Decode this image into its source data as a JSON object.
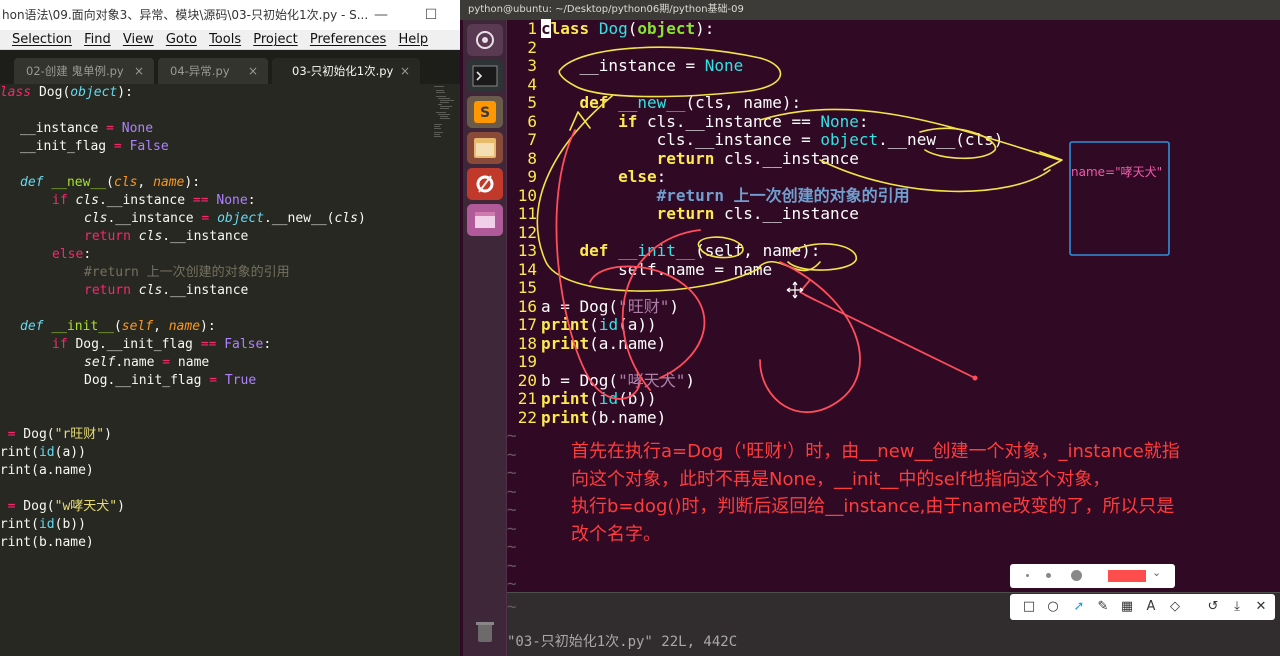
{
  "sublime": {
    "title": "hon语法\\09.面向对象3、异常、模块\\源码\\03-只初始化1次.py - S...",
    "menu": [
      "Selection",
      "Find",
      "View",
      "Goto",
      "Tools",
      "Project",
      "Preferences",
      "Help"
    ],
    "tabs": [
      {
        "label": "02-创建    鬼单例.py",
        "close": "×"
      },
      {
        "label": "04-异常.py",
        "close": "×"
      },
      {
        "label": "03-只初始化1次.py",
        "close": "×",
        "active": true
      }
    ],
    "code": [
      "class Dog(object):",
      "",
      "    __instance = None",
      "    __init_flag = False",
      "",
      "    def __new__(cls, name):",
      "        if cls.__instance == None:",
      "            cls.__instance = object.__new__(cls)",
      "            return cls.__instance",
      "        else:",
      "            #return 上一次创建的对象的引用",
      "            return cls.__instance",
      "",
      "    def __init__(self, name):",
      "        if Dog.__init_flag == False:",
      "            self.name = name",
      "            Dog.__init_flag = True",
      "",
      "",
      "a = Dog(\"r旺财\")",
      "print(id(a))",
      "print(a.name)",
      "",
      "b = Dog(\"w哮天犬\")",
      "print(id(b))",
      "print(b.name)"
    ]
  },
  "vm": {
    "title": "python@ubuntu: ~/Desktop/python06期/python基础-09",
    "vim_lines": [
      {
        "n": "1",
        "text": "class Dog(object):"
      },
      {
        "n": "2",
        "text": ""
      },
      {
        "n": "3",
        "text": "    __instance = None"
      },
      {
        "n": "4",
        "text": ""
      },
      {
        "n": "5",
        "text": "    def __new__(cls, name):"
      },
      {
        "n": "6",
        "text": "        if cls.__instance == None:"
      },
      {
        "n": "7",
        "text": "            cls.__instance = object.__new__(cls)"
      },
      {
        "n": "8",
        "text": "            return cls.__instance"
      },
      {
        "n": "9",
        "text": "        else:"
      },
      {
        "n": "10",
        "text": "            #return 上一次创建的对象的引用"
      },
      {
        "n": "11",
        "text": "            return cls.__instance"
      },
      {
        "n": "12",
        "text": ""
      },
      {
        "n": "13",
        "text": "    def __init__(self, name):"
      },
      {
        "n": "14",
        "text": "        self.name = name"
      },
      {
        "n": "15",
        "text": ""
      },
      {
        "n": "16",
        "text": "a = Dog(\"旺财\")"
      },
      {
        "n": "17",
        "text": "print(id(a))"
      },
      {
        "n": "18",
        "text": "print(a.name)"
      },
      {
        "n": "19",
        "text": ""
      },
      {
        "n": "20",
        "text": "b = Dog(\"哮天犬\")"
      },
      {
        "n": "21",
        "text": "print(id(b))"
      },
      {
        "n": "22",
        "text": "print(b.name)"
      }
    ],
    "tilde": "~",
    "status": "\"03-只初始化1次.py\" 22L, 442C"
  },
  "annotation": {
    "box_label": "name=\"哮天犬\"",
    "note_lines": [
      "首先在执行a=Dog（'旺财'）时，由__new__创建一个对象，_instance就指",
      "向这个对象，此时不再是None，__init__中的self也指向这个对象，",
      "执行b=dog()时，判断后返回给__instance,由于name改变的了，所以只是",
      "改个名字。"
    ],
    "pen_color": "#ff4d4d",
    "ink_yellow": "#f2e34a",
    "ink_red": "#ff4d5a",
    "box_color": "#2f8fd8"
  },
  "toolbar_icons": [
    "rectangle-icon",
    "ellipse-icon",
    "pointer-icon",
    "pen-icon",
    "mosaic-icon",
    "text-icon",
    "eraser-icon",
    "undo-icon",
    "save-icon",
    "close-icon"
  ]
}
